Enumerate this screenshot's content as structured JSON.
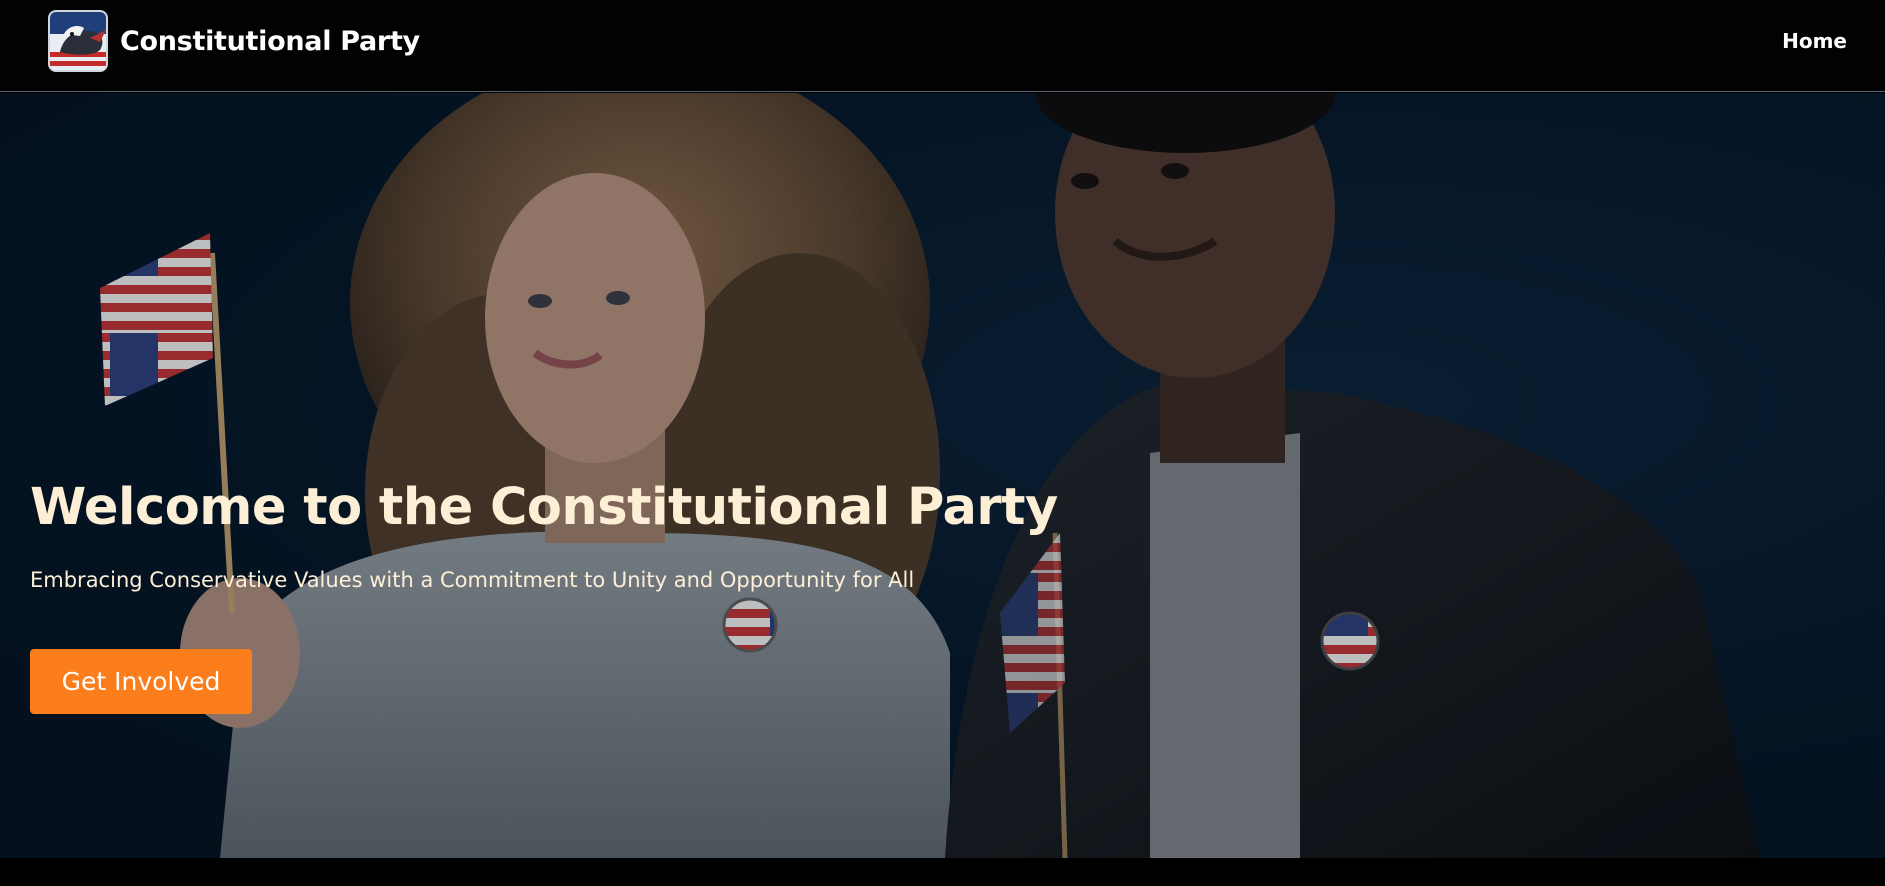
{
  "header": {
    "brand_name": "Constitutional Party",
    "nav": {
      "home_label": "Home"
    }
  },
  "hero": {
    "title": "Welcome to the Constitutional Party",
    "subtitle": "Embracing Conservative Values with a Commitment to Unity and Opportunity for All",
    "cta_label": "Get Involved"
  },
  "colors": {
    "accent": "#fb7d1b",
    "hero_text": "#fdefd6",
    "navbar_bg": "#020202",
    "hero_bg": "#061627"
  },
  "icons": {
    "logo": "eagle-flag-logo-icon"
  }
}
